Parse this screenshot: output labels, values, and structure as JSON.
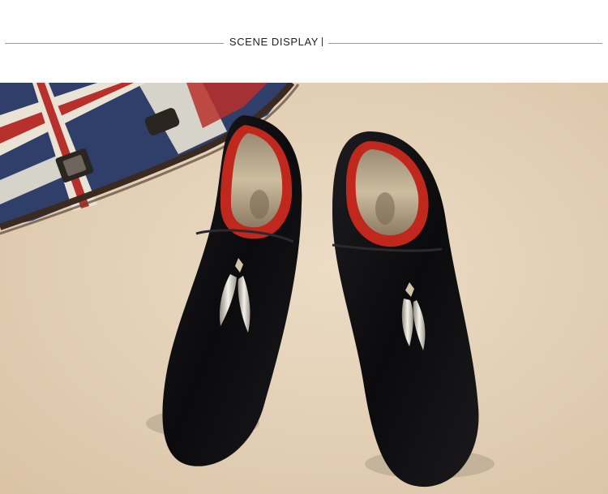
{
  "section": {
    "title": "SCENE DISPLAY"
  },
  "photo": {
    "subject": "black-velvet-loafers-with-metal-tassels",
    "colors": {
      "background": "#e6d2b8",
      "velvet": "#0d0d0f",
      "lining": "#c0281e",
      "insole": "#bfa98a",
      "metal": "#d8d4c8"
    }
  }
}
